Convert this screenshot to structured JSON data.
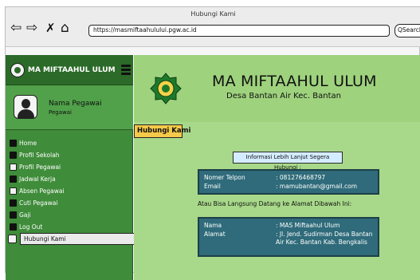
{
  "window": {
    "title": "Hubungi Kami"
  },
  "browser": {
    "url": "https://masmiftaahulului.pgw.ac.id",
    "search_label": "QSearch",
    "nav_icons": [
      "back-arrow-icon",
      "forward-arrow-icon",
      "close-icon",
      "home-icon"
    ]
  },
  "sidebar": {
    "brand": "MA MIFTAAHUL ULUM",
    "user": {
      "name": "Nama Pegawai",
      "role": "Pegawai"
    },
    "items": [
      {
        "label": "Home",
        "icon": "home-icon"
      },
      {
        "label": "Profil Sekolah",
        "icon": "school-icon"
      },
      {
        "label": "Profil Pegawai",
        "icon": "profile-icon"
      },
      {
        "label": "Jadwal Kerja",
        "icon": "calendar-icon"
      },
      {
        "label": "Absen Pegawai",
        "icon": "attendance-icon"
      },
      {
        "label": "Cuti Pegawai",
        "icon": "leave-icon"
      },
      {
        "label": "Gaji",
        "icon": "salary-icon"
      },
      {
        "label": "Log Out",
        "icon": "logout-icon"
      },
      {
        "label": "Hubungi Kami",
        "icon": "phone-icon",
        "active": true
      }
    ]
  },
  "header": {
    "title": "MA MIFTAAHUL ULUM",
    "subtitle": "Desa Bantan Air Kec. Bantan"
  },
  "page": {
    "button_label": "Hubungi Kami",
    "info_heading": "Informasi Lebih Lanjut Segera Hubungi :",
    "contact": {
      "phone_label": "Nomer Telpon",
      "phone_value": ": 081276468797",
      "email_label": "Email",
      "email_value": ": mamubantan@gmail.com"
    },
    "address_heading": "Atau Bisa Langsung Datang ke Alamat Dibawah Ini:",
    "address": {
      "name_label": "Nama",
      "name_value": ": MAS Miftaahul Ulum",
      "address_label": "Alamat",
      "address_value": ": Jl. Jend. Sudirman Desa Bantan Air Kec. Bantan Kab. Bengkalis"
    }
  },
  "colors": {
    "sidebar": "#3f8c3a",
    "sidebar_dark": "#2b6a28",
    "main_bg": "#a8d98a",
    "card": "#2f6b7a",
    "button": "#f5c94a"
  }
}
